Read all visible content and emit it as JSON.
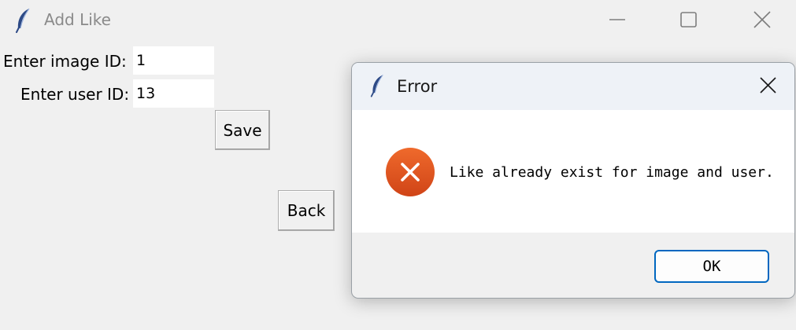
{
  "window": {
    "title": "Add Like",
    "icon": "feather-icon",
    "controls": [
      "minimize-icon",
      "maximize-icon",
      "close-icon"
    ]
  },
  "form": {
    "image_id_label": "Enter image ID:",
    "image_id_value": "1",
    "user_id_label": "Enter user ID:",
    "user_id_value": "13",
    "save_label": "Save",
    "back_label": "Back"
  },
  "dialog": {
    "title": "Error",
    "icon": "feather-icon",
    "message": "Like already exist for image and user.",
    "error_icon": "error-x-icon",
    "error_color": "#e0561f",
    "ok_label": "OK",
    "ok_border_color": "#0067c0"
  }
}
